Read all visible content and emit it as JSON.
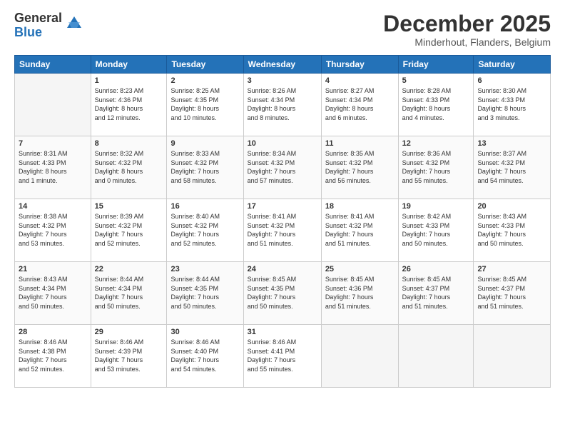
{
  "logo": {
    "line1": "General",
    "line2": "Blue"
  },
  "header": {
    "month": "December 2025",
    "location": "Minderhout, Flanders, Belgium"
  },
  "weekdays": [
    "Sunday",
    "Monday",
    "Tuesday",
    "Wednesday",
    "Thursday",
    "Friday",
    "Saturday"
  ],
  "weeks": [
    [
      {
        "day": "",
        "info": ""
      },
      {
        "day": "1",
        "info": "Sunrise: 8:23 AM\nSunset: 4:36 PM\nDaylight: 8 hours\nand 12 minutes."
      },
      {
        "day": "2",
        "info": "Sunrise: 8:25 AM\nSunset: 4:35 PM\nDaylight: 8 hours\nand 10 minutes."
      },
      {
        "day": "3",
        "info": "Sunrise: 8:26 AM\nSunset: 4:34 PM\nDaylight: 8 hours\nand 8 minutes."
      },
      {
        "day": "4",
        "info": "Sunrise: 8:27 AM\nSunset: 4:34 PM\nDaylight: 8 hours\nand 6 minutes."
      },
      {
        "day": "5",
        "info": "Sunrise: 8:28 AM\nSunset: 4:33 PM\nDaylight: 8 hours\nand 4 minutes."
      },
      {
        "day": "6",
        "info": "Sunrise: 8:30 AM\nSunset: 4:33 PM\nDaylight: 8 hours\nand 3 minutes."
      }
    ],
    [
      {
        "day": "7",
        "info": "Sunrise: 8:31 AM\nSunset: 4:33 PM\nDaylight: 8 hours\nand 1 minute."
      },
      {
        "day": "8",
        "info": "Sunrise: 8:32 AM\nSunset: 4:32 PM\nDaylight: 8 hours\nand 0 minutes."
      },
      {
        "day": "9",
        "info": "Sunrise: 8:33 AM\nSunset: 4:32 PM\nDaylight: 7 hours\nand 58 minutes."
      },
      {
        "day": "10",
        "info": "Sunrise: 8:34 AM\nSunset: 4:32 PM\nDaylight: 7 hours\nand 57 minutes."
      },
      {
        "day": "11",
        "info": "Sunrise: 8:35 AM\nSunset: 4:32 PM\nDaylight: 7 hours\nand 56 minutes."
      },
      {
        "day": "12",
        "info": "Sunrise: 8:36 AM\nSunset: 4:32 PM\nDaylight: 7 hours\nand 55 minutes."
      },
      {
        "day": "13",
        "info": "Sunrise: 8:37 AM\nSunset: 4:32 PM\nDaylight: 7 hours\nand 54 minutes."
      }
    ],
    [
      {
        "day": "14",
        "info": "Sunrise: 8:38 AM\nSunset: 4:32 PM\nDaylight: 7 hours\nand 53 minutes."
      },
      {
        "day": "15",
        "info": "Sunrise: 8:39 AM\nSunset: 4:32 PM\nDaylight: 7 hours\nand 52 minutes."
      },
      {
        "day": "16",
        "info": "Sunrise: 8:40 AM\nSunset: 4:32 PM\nDaylight: 7 hours\nand 52 minutes."
      },
      {
        "day": "17",
        "info": "Sunrise: 8:41 AM\nSunset: 4:32 PM\nDaylight: 7 hours\nand 51 minutes."
      },
      {
        "day": "18",
        "info": "Sunrise: 8:41 AM\nSunset: 4:32 PM\nDaylight: 7 hours\nand 51 minutes."
      },
      {
        "day": "19",
        "info": "Sunrise: 8:42 AM\nSunset: 4:33 PM\nDaylight: 7 hours\nand 50 minutes."
      },
      {
        "day": "20",
        "info": "Sunrise: 8:43 AM\nSunset: 4:33 PM\nDaylight: 7 hours\nand 50 minutes."
      }
    ],
    [
      {
        "day": "21",
        "info": "Sunrise: 8:43 AM\nSunset: 4:34 PM\nDaylight: 7 hours\nand 50 minutes."
      },
      {
        "day": "22",
        "info": "Sunrise: 8:44 AM\nSunset: 4:34 PM\nDaylight: 7 hours\nand 50 minutes."
      },
      {
        "day": "23",
        "info": "Sunrise: 8:44 AM\nSunset: 4:35 PM\nDaylight: 7 hours\nand 50 minutes."
      },
      {
        "day": "24",
        "info": "Sunrise: 8:45 AM\nSunset: 4:35 PM\nDaylight: 7 hours\nand 50 minutes."
      },
      {
        "day": "25",
        "info": "Sunrise: 8:45 AM\nSunset: 4:36 PM\nDaylight: 7 hours\nand 51 minutes."
      },
      {
        "day": "26",
        "info": "Sunrise: 8:45 AM\nSunset: 4:37 PM\nDaylight: 7 hours\nand 51 minutes."
      },
      {
        "day": "27",
        "info": "Sunrise: 8:45 AM\nSunset: 4:37 PM\nDaylight: 7 hours\nand 51 minutes."
      }
    ],
    [
      {
        "day": "28",
        "info": "Sunrise: 8:46 AM\nSunset: 4:38 PM\nDaylight: 7 hours\nand 52 minutes."
      },
      {
        "day": "29",
        "info": "Sunrise: 8:46 AM\nSunset: 4:39 PM\nDaylight: 7 hours\nand 53 minutes."
      },
      {
        "day": "30",
        "info": "Sunrise: 8:46 AM\nSunset: 4:40 PM\nDaylight: 7 hours\nand 54 minutes."
      },
      {
        "day": "31",
        "info": "Sunrise: 8:46 AM\nSunset: 4:41 PM\nDaylight: 7 hours\nand 55 minutes."
      },
      {
        "day": "",
        "info": ""
      },
      {
        "day": "",
        "info": ""
      },
      {
        "day": "",
        "info": ""
      }
    ]
  ]
}
